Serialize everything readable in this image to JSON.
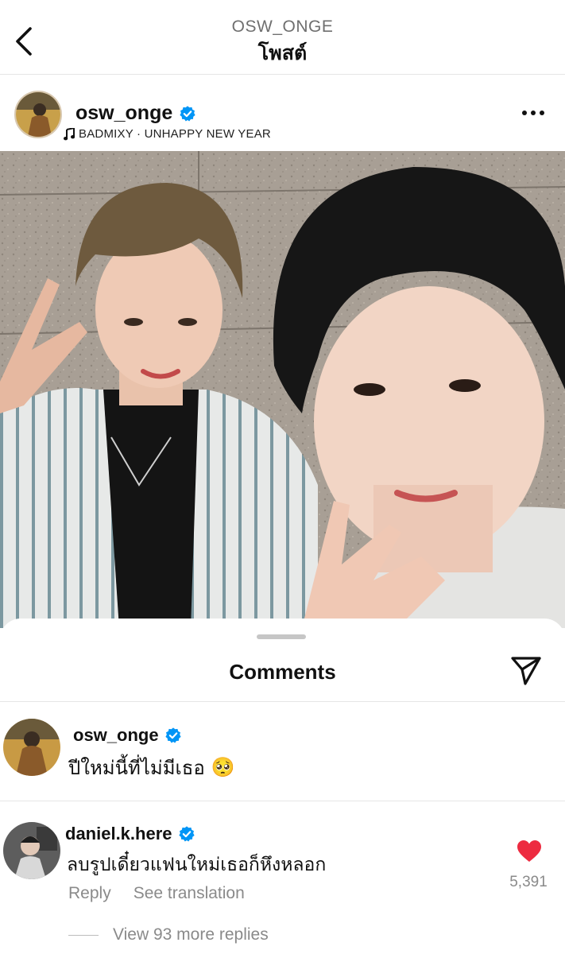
{
  "nav": {
    "account": "OSW_ONGE",
    "title": "โพสต์"
  },
  "post": {
    "username": "osw_onge",
    "music": "BADMIXY · UNHAPPY NEW YEAR"
  },
  "comments": {
    "title": "Comments",
    "items": [
      {
        "username": "osw_onge",
        "text": "ปีใหม่นี้ที่ไม่มีเธอ",
        "emoji": "🥺"
      },
      {
        "username": "daniel.k.here",
        "text": "ลบรูปเดี๋ยวแฟนใหม่เธอก็หึงหลอก",
        "reply_label": "Reply",
        "translate_label": "See translation",
        "likes": "5,391"
      }
    ],
    "view_replies": "View 93 more replies"
  },
  "colors": {
    "verified": "#0095f6",
    "like": "#ed2b40",
    "muted": "#8a8a8a"
  },
  "icons": [
    "chevron-left-icon",
    "verified-icon",
    "music-note-icon",
    "more-horizontal-icon",
    "share-send-icon",
    "heart-icon"
  ]
}
